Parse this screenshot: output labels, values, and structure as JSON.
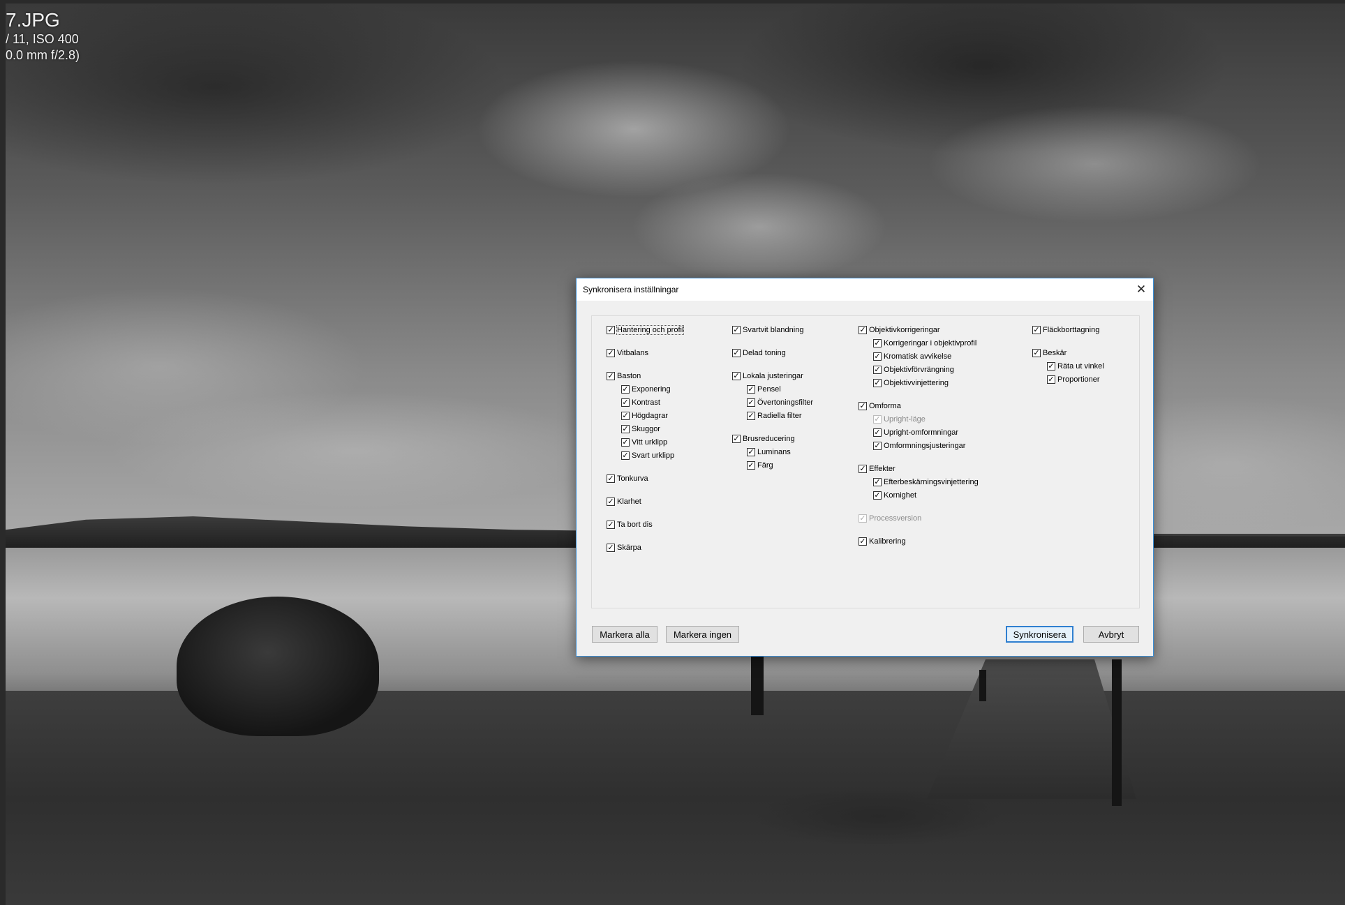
{
  "photo_info": {
    "filename": "7.JPG",
    "exposure": "/ 11, ISO 400",
    "lens": "0.0 mm f/2.8)"
  },
  "dialog": {
    "title": "Synkronisera inställningar",
    "close_icon": "close-icon",
    "columns": [
      {
        "groups": [
          {
            "label": "Hantering och profil",
            "checked": true,
            "focused": true,
            "children": []
          },
          {
            "label": "Vitbalans",
            "checked": true,
            "children": []
          },
          {
            "label": "Baston",
            "checked": true,
            "children": [
              {
                "label": "Exponering",
                "checked": true
              },
              {
                "label": "Kontrast",
                "checked": true
              },
              {
                "label": "Högdagrar",
                "checked": true
              },
              {
                "label": "Skuggor",
                "checked": true
              },
              {
                "label": "Vitt urklipp",
                "checked": true
              },
              {
                "label": "Svart urklipp",
                "checked": true
              }
            ]
          },
          {
            "label": "Tonkurva",
            "checked": true,
            "children": []
          },
          {
            "label": "Klarhet",
            "checked": true,
            "children": []
          },
          {
            "label": "Ta bort dis",
            "checked": true,
            "children": []
          },
          {
            "label": "Skärpa",
            "checked": true,
            "children": []
          }
        ]
      },
      {
        "groups": [
          {
            "label": "Svartvit blandning",
            "checked": true,
            "children": []
          },
          {
            "label": "Delad toning",
            "checked": true,
            "children": []
          },
          {
            "label": "Lokala justeringar",
            "checked": true,
            "children": [
              {
                "label": "Pensel",
                "checked": true
              },
              {
                "label": "Övertoningsfilter",
                "checked": true
              },
              {
                "label": "Radiella filter",
                "checked": true
              }
            ]
          },
          {
            "label": "Brusreducering",
            "checked": true,
            "children": [
              {
                "label": "Luminans",
                "checked": true
              },
              {
                "label": "Färg",
                "checked": true
              }
            ]
          }
        ]
      },
      {
        "groups": [
          {
            "label": "Objektivkorrigeringar",
            "checked": true,
            "children": [
              {
                "label": "Korrigeringar i objektivprofil",
                "checked": true
              },
              {
                "label": "Kromatisk avvikelse",
                "checked": true
              },
              {
                "label": "Objektivförvrängning",
                "checked": true
              },
              {
                "label": "Objektivvinjettering",
                "checked": true
              }
            ]
          },
          {
            "label": "Omforma",
            "checked": true,
            "children": [
              {
                "label": "Upright-läge",
                "checked": true,
                "disabled": true
              },
              {
                "label": "Upright-omformningar",
                "checked": true
              },
              {
                "label": "Omformningsjusteringar",
                "checked": true
              }
            ]
          },
          {
            "label": "Effekter",
            "checked": true,
            "children": [
              {
                "label": "Efterbeskärningsvinjettering",
                "checked": true
              },
              {
                "label": "Kornighet",
                "checked": true
              }
            ]
          },
          {
            "label": "Processversion",
            "checked": true,
            "disabled": true,
            "children": []
          },
          {
            "label": "Kalibrering",
            "checked": true,
            "children": []
          }
        ]
      },
      {
        "groups": [
          {
            "label": "Fläckborttagning",
            "checked": true,
            "children": []
          },
          {
            "label": "Beskär",
            "checked": true,
            "children": [
              {
                "label": "Räta ut vinkel",
                "checked": true
              },
              {
                "label": "Proportioner",
                "checked": true
              }
            ]
          }
        ]
      }
    ],
    "buttons": {
      "select_all": "Markera alla",
      "select_none": "Markera ingen",
      "synchronize": "Synkronisera",
      "cancel": "Avbryt"
    }
  }
}
